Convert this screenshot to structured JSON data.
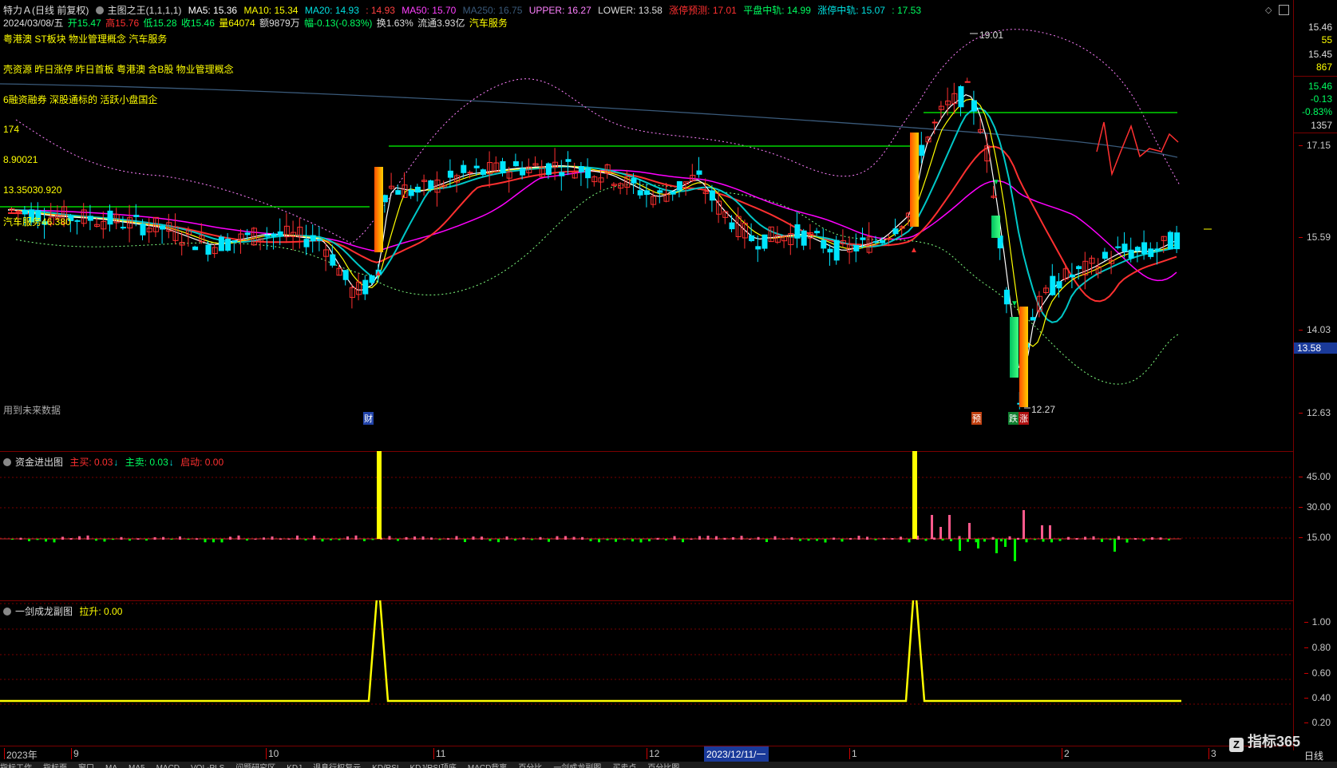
{
  "header": {
    "stock_name": "特力Ａ(日线 前复权)",
    "formula": "主图之王(1,1,1,1)",
    "ma5": "MA5: 15.36",
    "ma10": "MA10: 15.34",
    "ma20": "MA20: 14.93",
    "ma_extra": ": 14.93",
    "ma50": "MA50: 15.70",
    "ma250": "MA250: 16.75",
    "upper": "UPPER: 16.27",
    "lower": "LOWER: 13.58",
    "limit_up_forecast": "涨停预测: 17.01",
    "flat_mid": "平盘中轨: 14.99",
    "limit_mid": "涨停中轨: 15.07",
    "last_val": ": 17.53"
  },
  "quote": {
    "date": "2024/03/08/五",
    "open": "开15.47",
    "high": "高15.76",
    "low": "低15.28",
    "close": "收15.46",
    "volume": "量64074",
    "amount": "额9879万",
    "change": "幅-0.13(-0.83%)",
    "turnover": "换1.63%",
    "float_cap": "流通3.93亿",
    "sector": "汽车服务"
  },
  "concept_lines": [
    "粤港澳 ST板块 物业管理概念 汽车服务",
    "壳资源 昨日涨停 昨日首板 粤港澳 含B股 物业管理概念",
    "6融资融券 深股通标的 活跃小盘国企"
  ],
  "side_labels": [
    "174",
    "8.90021",
    "13.35030.920",
    "汽车服务46.380"
  ],
  "annotations": {
    "high_label": "19.01",
    "low_label": "12.27",
    "future_data": "用到未来数据",
    "marker_cai": "财",
    "marker_yu": "预",
    "marker_die": "跌",
    "marker_zhang": "涨"
  },
  "price_axis": {
    "ticks": [
      "17.15",
      "15.59",
      "14.03",
      "12.63"
    ],
    "current_price_box": "13.58",
    "quote_panel": [
      "15.46",
      "55",
      "15.45",
      "867",
      "15.46",
      "-0.13",
      "-0.83%",
      "1357"
    ]
  },
  "indicator1": {
    "title": "资金进出图",
    "buy": "主买: 0.03",
    "sell": "主卖: 0.03",
    "start": "启动: 0.00",
    "ticks": [
      "45.00",
      "30.00",
      "15.00"
    ]
  },
  "indicator2": {
    "title": "一剑成龙副图",
    "lift": "拉升: 0.00",
    "ticks": [
      "1.00",
      "0.80",
      "0.60",
      "0.40",
      "0.20"
    ]
  },
  "x_axis": {
    "labels": [
      "2023年",
      "9",
      "10",
      "11",
      "12",
      "2023/12/11/一",
      "1",
      "2",
      "3"
    ]
  },
  "corner": {
    "logo": "指标365",
    "period": "日线"
  },
  "bottom_tabs": [
    "指标工作",
    "指标面",
    "窗口",
    "MA",
    "MA5",
    "MACD",
    "VOL-PLS",
    "问题研究区",
    "KDJ",
    "退息行权复元",
    "KD/RSI",
    "KDJ/RSI顶底",
    "MACD背离",
    "百分比",
    "一剑成龙副图",
    "买卖点",
    "百分比图"
  ],
  "colors": {
    "up": "#ff3030",
    "down": "#00e5ff",
    "ma5": "#ffffff",
    "ma10": "#ffff00",
    "ma20": "#ff00ff",
    "ma50": "#00c8c8",
    "line_green": "#00ff00",
    "bar_yellow": "#ffff00",
    "bar_pink": "#ff5a8c"
  }
}
